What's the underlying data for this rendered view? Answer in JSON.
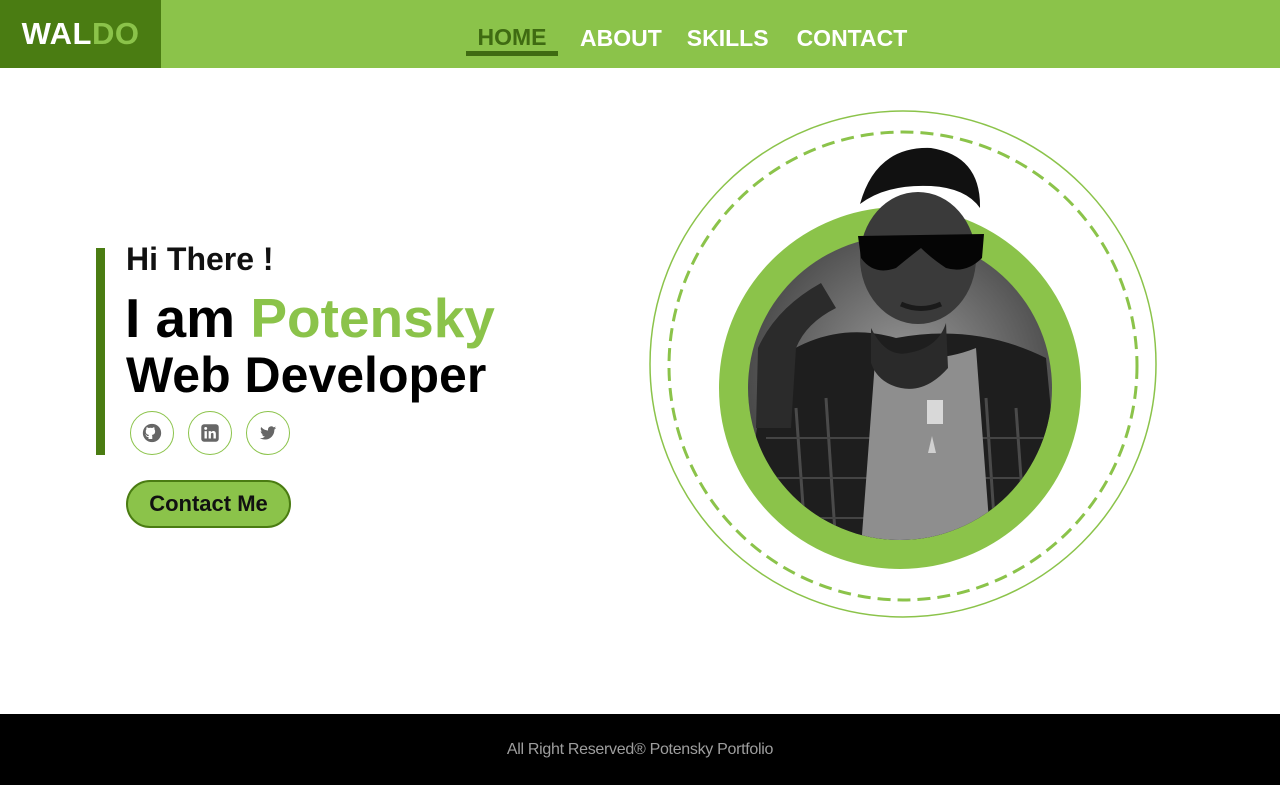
{
  "brand": {
    "logo_part1": "WAL",
    "logo_part2": "DO"
  },
  "nav": {
    "items": [
      {
        "label": "HOME",
        "active": true
      },
      {
        "label": "ABOUT",
        "active": false
      },
      {
        "label": "SKILLS",
        "active": false
      },
      {
        "label": "CONTACT",
        "active": false
      }
    ]
  },
  "hero": {
    "greeting": "Hi There !",
    "headline_prefix": "I am ",
    "name": "Potensky",
    "role": "Web Developer",
    "socials": [
      {
        "name": "github",
        "icon": "github-icon"
      },
      {
        "name": "linkedin",
        "icon": "linkedin-icon"
      },
      {
        "name": "twitter",
        "icon": "twitter-icon"
      }
    ],
    "cta_label": "Contact Me"
  },
  "footer": {
    "text": "All Right Reserved®  Potensky Portfolio"
  },
  "colors": {
    "accent": "#8bc34a",
    "accent_dark": "#4a7c12",
    "nav_active": "#3f6b12",
    "footer_bg": "#000000",
    "footer_text": "#9e9e9e"
  }
}
